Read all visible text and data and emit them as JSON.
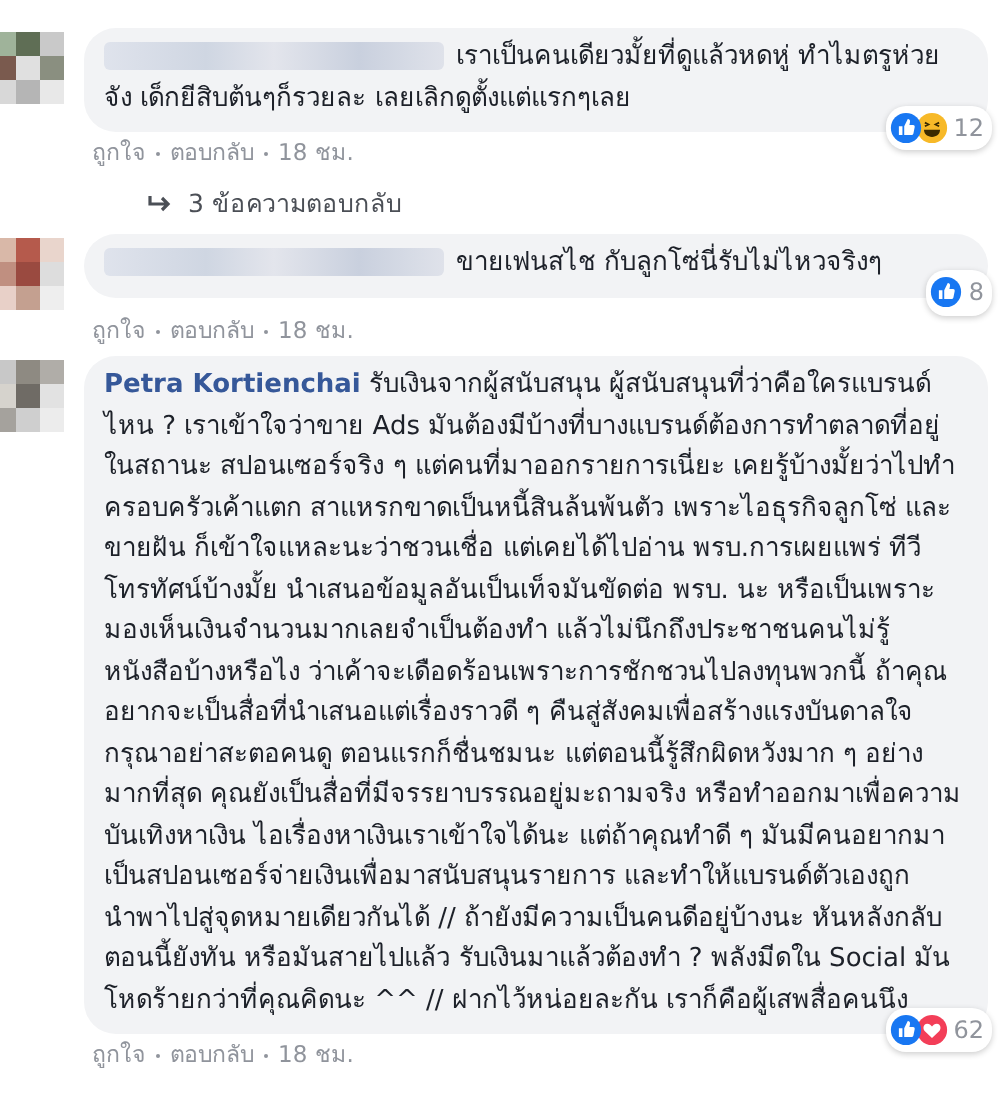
{
  "comments": [
    {
      "author_blurred": true,
      "text": "เราเป็นคนเดียวมั้ยที่ดูแล้วหดหู่ ทำไมตรูห่วยจัง เด็กยีสิบต้นๆก็รวยละ เลยเลิกดูตั้งแต่แรกๆเลย",
      "reactions": [
        {
          "kind": "like"
        },
        {
          "kind": "haha"
        }
      ],
      "reaction_count": "12",
      "actions": [
        "ถูกใจ",
        "ตอบกลับ",
        "18 ชม."
      ],
      "replies_link": "3 ข้อความตอบกลับ"
    },
    {
      "author_blurred": true,
      "text": "ขายเฟนสไช กับลูกโซ่นี่รับไม่ไหวจริงๆ",
      "reactions": [
        {
          "kind": "like"
        }
      ],
      "reaction_count": "8",
      "actions": [
        "ถูกใจ",
        "ตอบกลับ",
        "18 ชม."
      ]
    },
    {
      "author_blurred": false,
      "author": "Petra Kortienchai",
      "text": "รับเงินจากผู้สนับสนุน ผู้สนับสนุนที่ว่าคือใครแบรนด์ไหน ? เราเข้าใจว่าขาย Ads มันต้องมีบ้างที่บางแบรนด์ต้องการทำตลาดที่อยู่ในสถานะ สปอนเซอร์จริง ๆ แต่คนที่มาออกรายการเนี่ยะ เคยรู้บ้างมั้ยว่าไปทำครอบครัวเค้าแตก สาแหรกขาดเป็นหนี้สินล้นพ้นตัว เพราะไอธุรกิจลูกโซ่ และขายฝัน ก็เข้าใจแหละนะว่าชวนเชื่อ แต่เคยได้ไปอ่าน พรบ.การเผยแพร่ ทีวีโทรทัศน์บ้างมั้ย นำเสนอข้อมูลอันเป็นเท็จมันขัดต่อ พรบ. นะ หรือเป็นเพราะมองเห็นเงินจำนวนมากเลยจำเป็นต้องทำ แล้วไม่นึกถึงประชาชนคนไม่รู้หนังสือบ้างหรือไง ว่าเค้าจะเดือดร้อนเพราะการชักชวนไปลงทุนพวกนี้ ถ้าคุณอยากจะเป็นสื่อที่นำเสนอแต่เรื่องราวดี ๆ คืนสู่สังคมเพื่อสร้างแรงบันดาลใจ กรุณาอย่าสะตอคนดู ตอนแรกก็ชื่นชมนะ แต่ตอนนี้รู้สึกผิดหวังมาก ๆ อย่างมากที่สุด คุณยังเป็นสื่อที่มีจรรยาบรรณอยู่มะถามจริง หรือทำออกมาเพื่อความบันเทิงหาเงิน ไอเรื่องหาเงินเราเข้าใจได้นะ แต่ถ้าคุณทำดี ๆ มันมีคนอยากมาเป็นสปอนเซอร์จ่ายเงินเพื่อมาสนับสนุนรายการ และทำให้แบรนด์ตัวเองถูกนำพาไปสู่จุดหมายเดียวกันได้ // ถ้ายังมีความเป็นคนดีอยู่บ้างนะ หันหลังกลับตอนนี้ยังทัน หรือมันสายไปแล้ว รับเงินมาแล้วต้องทำ ? พลังมีดใน Social มันโหดร้ายกว่าที่คุณคิดนะ ^^ // ฝากไว้หน่อยละกัน เราก็คือผู้เสพสื่อคนนึง",
      "reactions": [
        {
          "kind": "like"
        },
        {
          "kind": "love"
        }
      ],
      "reaction_count": "62",
      "actions": [
        "ถูกใจ",
        "ตอบกลับ",
        "18 ชม."
      ]
    }
  ]
}
